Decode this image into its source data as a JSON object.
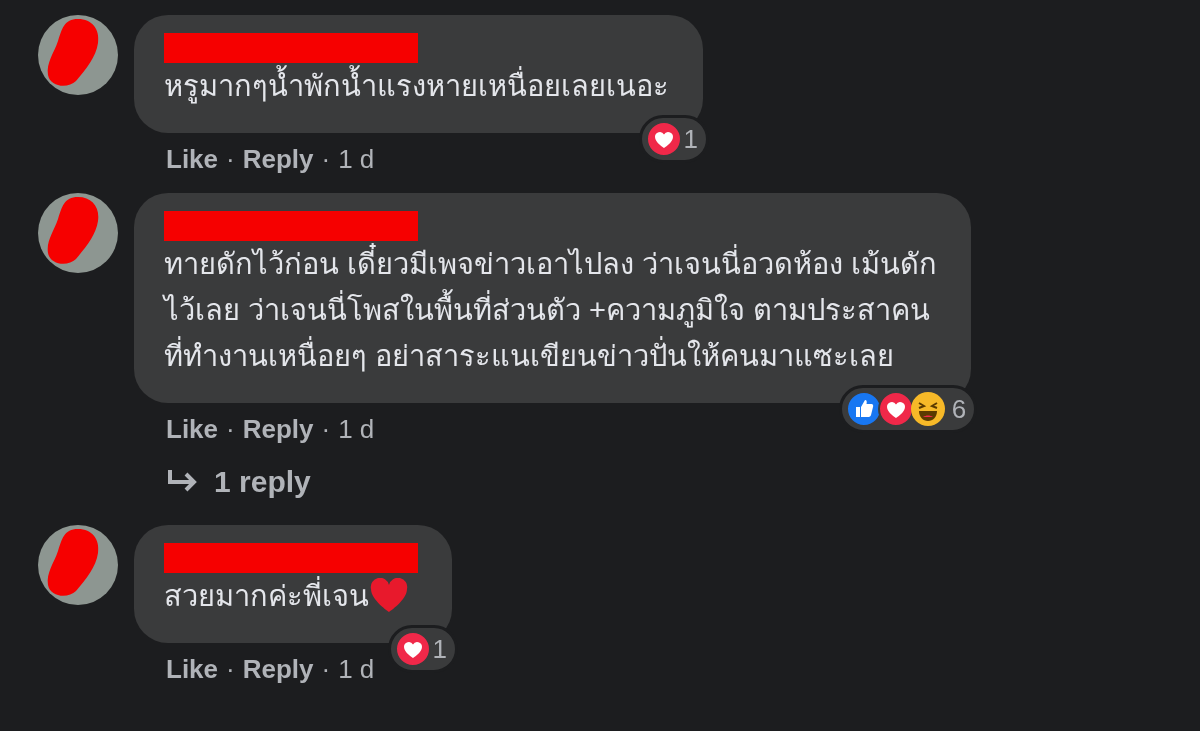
{
  "comments": [
    {
      "name_hidden": true,
      "text": "หรูมากๆน้ำพักน้ำแรงหายเหนื่อยเลยเนอะ",
      "reactions": [
        {
          "kind": "love"
        }
      ],
      "reaction_count": "1",
      "footer": [
        {
          "kind": "action",
          "text": "Like"
        },
        {
          "kind": "dot",
          "text": "·"
        },
        {
          "kind": "action",
          "text": "Reply"
        },
        {
          "kind": "dot",
          "text": "·"
        },
        {
          "kind": "time",
          "text": "1 d"
        }
      ]
    },
    {
      "name_hidden": true,
      "text": "ทายดักไว้ก่อน เดี๋ยวมีเพจข่าวเอาไปลง ว่าเจนนี่อวดห้อง เม้นดัก\nไว้เลย ว่าเจนนี่โพสในพื้นที่ส่วนตัว +ความภูมิใจ ตามประสาคน\nที่ทำงานเหนื่อยๆ อย่าสาระแนเขียนข่าวปั่นให้คนมาแซะเลย",
      "reactions": [
        {
          "kind": "like"
        },
        {
          "kind": "love"
        },
        {
          "kind": "haha"
        }
      ],
      "reaction_count": "6",
      "footer": [
        {
          "kind": "action",
          "text": "Like"
        },
        {
          "kind": "dot",
          "text": "·"
        },
        {
          "kind": "action",
          "text": "Reply"
        },
        {
          "kind": "dot",
          "text": "·"
        },
        {
          "kind": "time",
          "text": "1 d"
        }
      ],
      "replies_link": "1 reply"
    },
    {
      "name_hidden": true,
      "text": "สวยมากค่ะพี่เจน",
      "trailing_emoji": {
        "kind": "heart"
      },
      "reactions": [
        {
          "kind": "love"
        }
      ],
      "reaction_count": "1",
      "footer": [
        {
          "kind": "action",
          "text": "Like"
        },
        {
          "kind": "dot",
          "text": "·"
        },
        {
          "kind": "action",
          "text": "Reply"
        },
        {
          "kind": "dot",
          "text": "·"
        },
        {
          "kind": "time",
          "text": "1 d"
        }
      ]
    }
  ]
}
